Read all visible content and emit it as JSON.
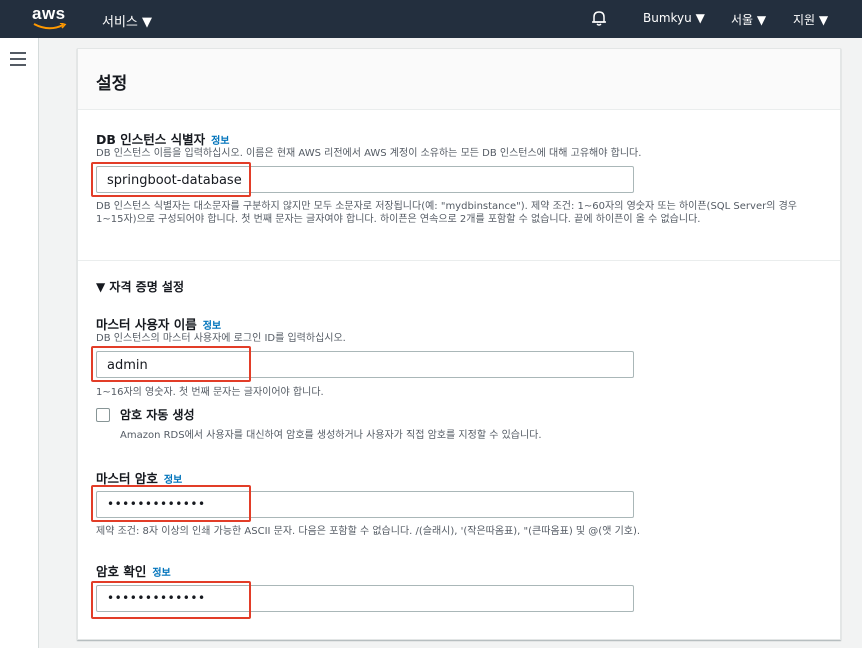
{
  "topbar": {
    "logo_text": "aws",
    "services_label": "서비스 ▼",
    "user_label": "Bumkyu ▼",
    "region_label": "서울 ▼",
    "support_label": "지원 ▼"
  },
  "panel": {
    "title": "설정",
    "info_label": "정보",
    "db_identifier": {
      "label": "DB 인스턴스 식별자",
      "description": "DB 인스턴스 이름을 입력하십시오. 이름은 현재 AWS 리전에서 AWS 계정이 소유하는 모든 DB 인스턴스에 대해 고유해야 합니다.",
      "value": "springboot-database",
      "constraint": "DB 인스턴스 식별자는 대소문자를 구분하지 않지만 모두 소문자로 저장됩니다(예: \"mydbinstance\"). 제약 조건: 1~60자의 영숫자 또는 하이픈(SQL Server의 경우 1~15자)으로 구성되어야 합니다. 첫 번째 문자는 글자여야 합니다. 하이픈은 연속으로 2개를 포함할 수 없습니다. 끝에 하이픈이 올 수 없습니다."
    },
    "credentials": {
      "section_title": "▼ 자격 증명 설정",
      "master_username": {
        "label": "마스터 사용자 이름",
        "description": "DB 인스턴스의 마스터 사용자에 로그인 ID를 입력하십시오.",
        "value": "admin",
        "constraint": "1~16자의 영숫자. 첫 번째 문자는 글자이어야 합니다."
      },
      "auto_password": {
        "label": "암호 자동 생성",
        "description": "Amazon RDS에서 사용자를 대신하여 암호를 생성하거나 사용자가 직접 암호를 지정할 수 있습니다.",
        "checked": false
      },
      "master_password": {
        "label": "마스터 암호",
        "value": "•••••••••••••",
        "constraint": "제약 조건: 8자 이상의 인쇄 가능한 ASCII 문자. 다음은 포함할 수 없습니다. /(슬래시), '(작은따옴표), \"(큰따옴표) 및 @(앳 기호)."
      },
      "confirm_password": {
        "label": "암호 확인",
        "value": "•••••••••••••"
      }
    }
  },
  "colors": {
    "topbar_bg": "#232f3e",
    "link": "#0073bb",
    "highlight_box": "#e23d28"
  }
}
